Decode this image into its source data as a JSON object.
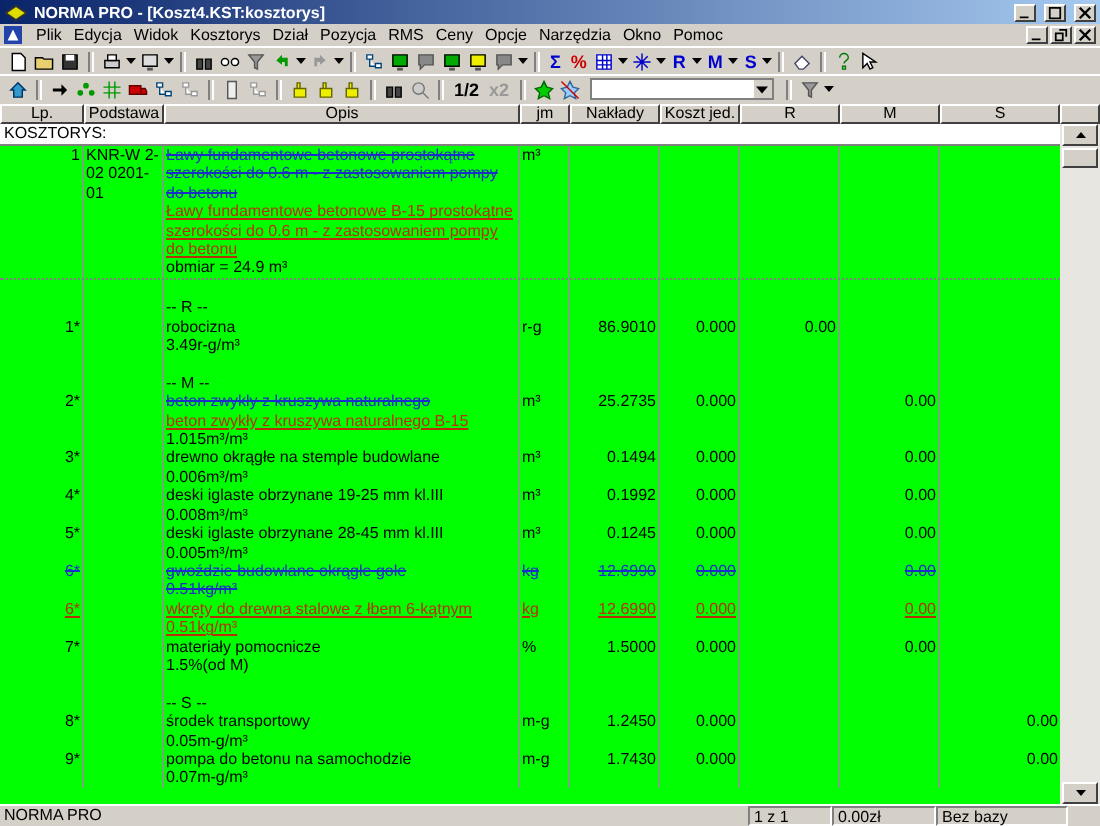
{
  "window": {
    "title": "NORMA PRO - [Koszt4.KST:kosztorys]"
  },
  "menu": [
    "Plik",
    "Edycja",
    "Widok",
    "Kosztorys",
    "Dział",
    "Pozycja",
    "RMS",
    "Ceny",
    "Opcje",
    "Narzędzia",
    "Okno",
    "Pomoc"
  ],
  "toolbar_labels": [
    "Σ",
    "%",
    "R",
    "M",
    "S",
    "1/2",
    "x2"
  ],
  "table": {
    "columns": [
      "Lp.",
      "Podstawa",
      "Opis",
      "jm",
      "Nakłady",
      "Koszt jed.",
      "R",
      "M",
      "S"
    ],
    "section_title": "KOSZTORYS:",
    "rows": [
      {
        "kind": "position",
        "deleted": false,
        "added": false,
        "lp": "1",
        "podstawa": "KNR-W 2-02 0201-01",
        "lines": [
          {
            "kind": "old",
            "text": "Ławy fundamentowe betonowe prostokątne szerokości do 0.6 m - z zastosowaniem pompy do betonu"
          },
          {
            "kind": "new",
            "text": "Ławy fundamentowe betonowe B-15 prostokątne szerokości do 0.6 m - z zastosowaniem pompy do betonu"
          },
          {
            "kind": "plain",
            "text": "obmiar  = 24.9 m³"
          }
        ],
        "jm": "m³"
      },
      {
        "kind": "section",
        "deleted": false,
        "added": false,
        "lines": [
          {
            "kind": "plain",
            "text": "-- R --"
          }
        ]
      },
      {
        "kind": "resource",
        "deleted": false,
        "added": false,
        "lp": "1*",
        "lines": [
          {
            "kind": "plain",
            "text": "robocizna"
          },
          {
            "kind": "plain",
            "text": "3.49r-g/m³"
          }
        ],
        "jm": "r-g",
        "naklady": "86.9010",
        "koszt": "0.000",
        "r": "0.00"
      },
      {
        "kind": "section",
        "deleted": false,
        "added": false,
        "lines": [
          {
            "kind": "plain",
            "text": "-- M --"
          }
        ]
      },
      {
        "kind": "resource",
        "deleted": false,
        "added": false,
        "lp": "2*",
        "lines": [
          {
            "kind": "old",
            "text": "beton zwykły z kruszywa naturalnego"
          },
          {
            "kind": "new",
            "text": "beton zwykły z kruszywa naturalnego B-15"
          },
          {
            "kind": "plain",
            "text": "1.015m³/m³"
          }
        ],
        "jm": "m³",
        "naklady": "25.2735",
        "koszt": "0.000",
        "m": "0.00"
      },
      {
        "kind": "resource",
        "deleted": false,
        "added": false,
        "lp": "3*",
        "lines": [
          {
            "kind": "plain",
            "text": "drewno okrągłe na stemple budowlane"
          },
          {
            "kind": "plain",
            "text": "0.006m³/m³"
          }
        ],
        "jm": "m³",
        "naklady": "0.1494",
        "koszt": "0.000",
        "m": "0.00"
      },
      {
        "kind": "resource",
        "deleted": false,
        "added": false,
        "lp": "4*",
        "lines": [
          {
            "kind": "plain",
            "text": "deski iglaste obrzynane 19-25 mm kl.III"
          },
          {
            "kind": "plain",
            "text": "0.008m³/m³"
          }
        ],
        "jm": "m³",
        "naklady": "0.1992",
        "koszt": "0.000",
        "m": "0.00"
      },
      {
        "kind": "resource",
        "deleted": false,
        "added": false,
        "lp": "5*",
        "lines": [
          {
            "kind": "plain",
            "text": "deski iglaste obrzynane 28-45 mm kl.III"
          },
          {
            "kind": "plain",
            "text": "0.005m³/m³"
          }
        ],
        "jm": "m³",
        "naklady": "0.1245",
        "koszt": "0.000",
        "m": "0.00"
      },
      {
        "kind": "resource",
        "deleted": true,
        "added": false,
        "lp": "6*",
        "lines": [
          {
            "kind": "plain",
            "text": "gwoździe budowlane okrągłe gołe"
          },
          {
            "kind": "plain",
            "text": "0.51kg/m³"
          }
        ],
        "jm": "kg",
        "naklady": "12.6990",
        "koszt": "0.000",
        "m": "0.00"
      },
      {
        "kind": "resource",
        "deleted": false,
        "added": true,
        "lp": "6*",
        "lines": [
          {
            "kind": "plain",
            "text": "wkręty do drewna stalowe z łbem 6-kątnym"
          },
          {
            "kind": "plain",
            "text": "0.51kg/m³"
          }
        ],
        "jm": "kg",
        "naklady": "12.6990",
        "koszt": "0.000",
        "m": "0.00"
      },
      {
        "kind": "resource",
        "deleted": false,
        "added": false,
        "lp": "7*",
        "lines": [
          {
            "kind": "plain",
            "text": "materiały pomocnicze"
          },
          {
            "kind": "plain",
            "text": "1.5%(od M)"
          }
        ],
        "jm": "%",
        "naklady": "1.5000",
        "koszt": "0.000",
        "m": "0.00"
      },
      {
        "kind": "section",
        "deleted": false,
        "added": false,
        "lines": [
          {
            "kind": "plain",
            "text": "-- S --"
          }
        ]
      },
      {
        "kind": "resource",
        "deleted": false,
        "added": false,
        "lp": "8*",
        "lines": [
          {
            "kind": "plain",
            "text": "środek transportowy"
          },
          {
            "kind": "plain",
            "text": "0.05m-g/m³"
          }
        ],
        "jm": "m-g",
        "naklady": "1.2450",
        "koszt": "0.000",
        "s": "0.00"
      },
      {
        "kind": "resource",
        "deleted": false,
        "added": false,
        "lp": "9*",
        "lines": [
          {
            "kind": "plain",
            "text": "pompa do betonu na samochodzie"
          },
          {
            "kind": "plain",
            "text": "0.07m-g/m³"
          }
        ],
        "jm": "m-g",
        "naklady": "1.7430",
        "koszt": "0.000",
        "s": "0.00"
      }
    ]
  },
  "status_bar": [
    "NORMA PRO",
    "1 z 1",
    "0.00zł",
    "Bez bazy"
  ]
}
